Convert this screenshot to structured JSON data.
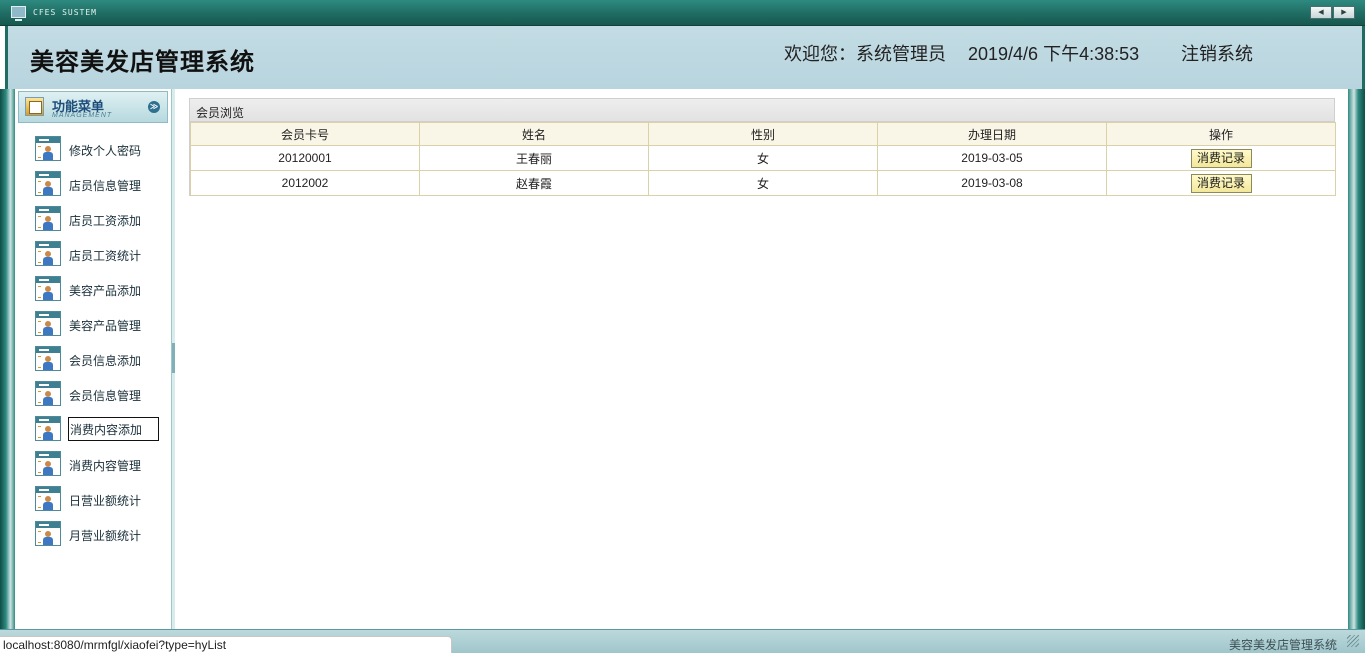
{
  "topbar": {
    "system_label": "CFES SUSTEM",
    "nav_prev": "◀",
    "nav_next": "▶"
  },
  "header": {
    "app_title": "美容美发店管理系统",
    "welcome": "欢迎您：系统管理员",
    "datetime": "2019/4/6 下午4:38:53",
    "logout": "注销系统"
  },
  "sidebar": {
    "menu_title": "功能菜单",
    "menu_subtitle": "MANAGEMENT",
    "items": [
      {
        "label": "修改个人密码"
      },
      {
        "label": "店员信息管理"
      },
      {
        "label": "店员工资添加"
      },
      {
        "label": "店员工资统计"
      },
      {
        "label": "美容产品添加"
      },
      {
        "label": "美容产品管理"
      },
      {
        "label": "会员信息添加"
      },
      {
        "label": "会员信息管理"
      },
      {
        "label": "消费内容添加"
      },
      {
        "label": "消费内容管理"
      },
      {
        "label": "日营业额统计"
      },
      {
        "label": "月营业额统计"
      }
    ]
  },
  "main": {
    "panel_title": "会员浏览",
    "columns": [
      "会员卡号",
      "姓名",
      "性别",
      "办理日期",
      "操作"
    ],
    "rows": [
      {
        "card": "20120001",
        "name": "王春丽",
        "gender": "女",
        "date": "2019-03-05",
        "action": "消费记录"
      },
      {
        "card": "2012002",
        "name": "赵春霞",
        "gender": "女",
        "date": "2019-03-08",
        "action": "消费记录"
      }
    ]
  },
  "footer": {
    "text": "美容美发店管理系统"
  },
  "status": {
    "url": "localhost:8080/mrmfgl/xiaofei?type=hyList"
  },
  "colors": {
    "frame": "#1f6c63",
    "header_bg": "#c3dce4",
    "button_bg": "#f3e79a",
    "table_border": "#d9d2a8"
  }
}
